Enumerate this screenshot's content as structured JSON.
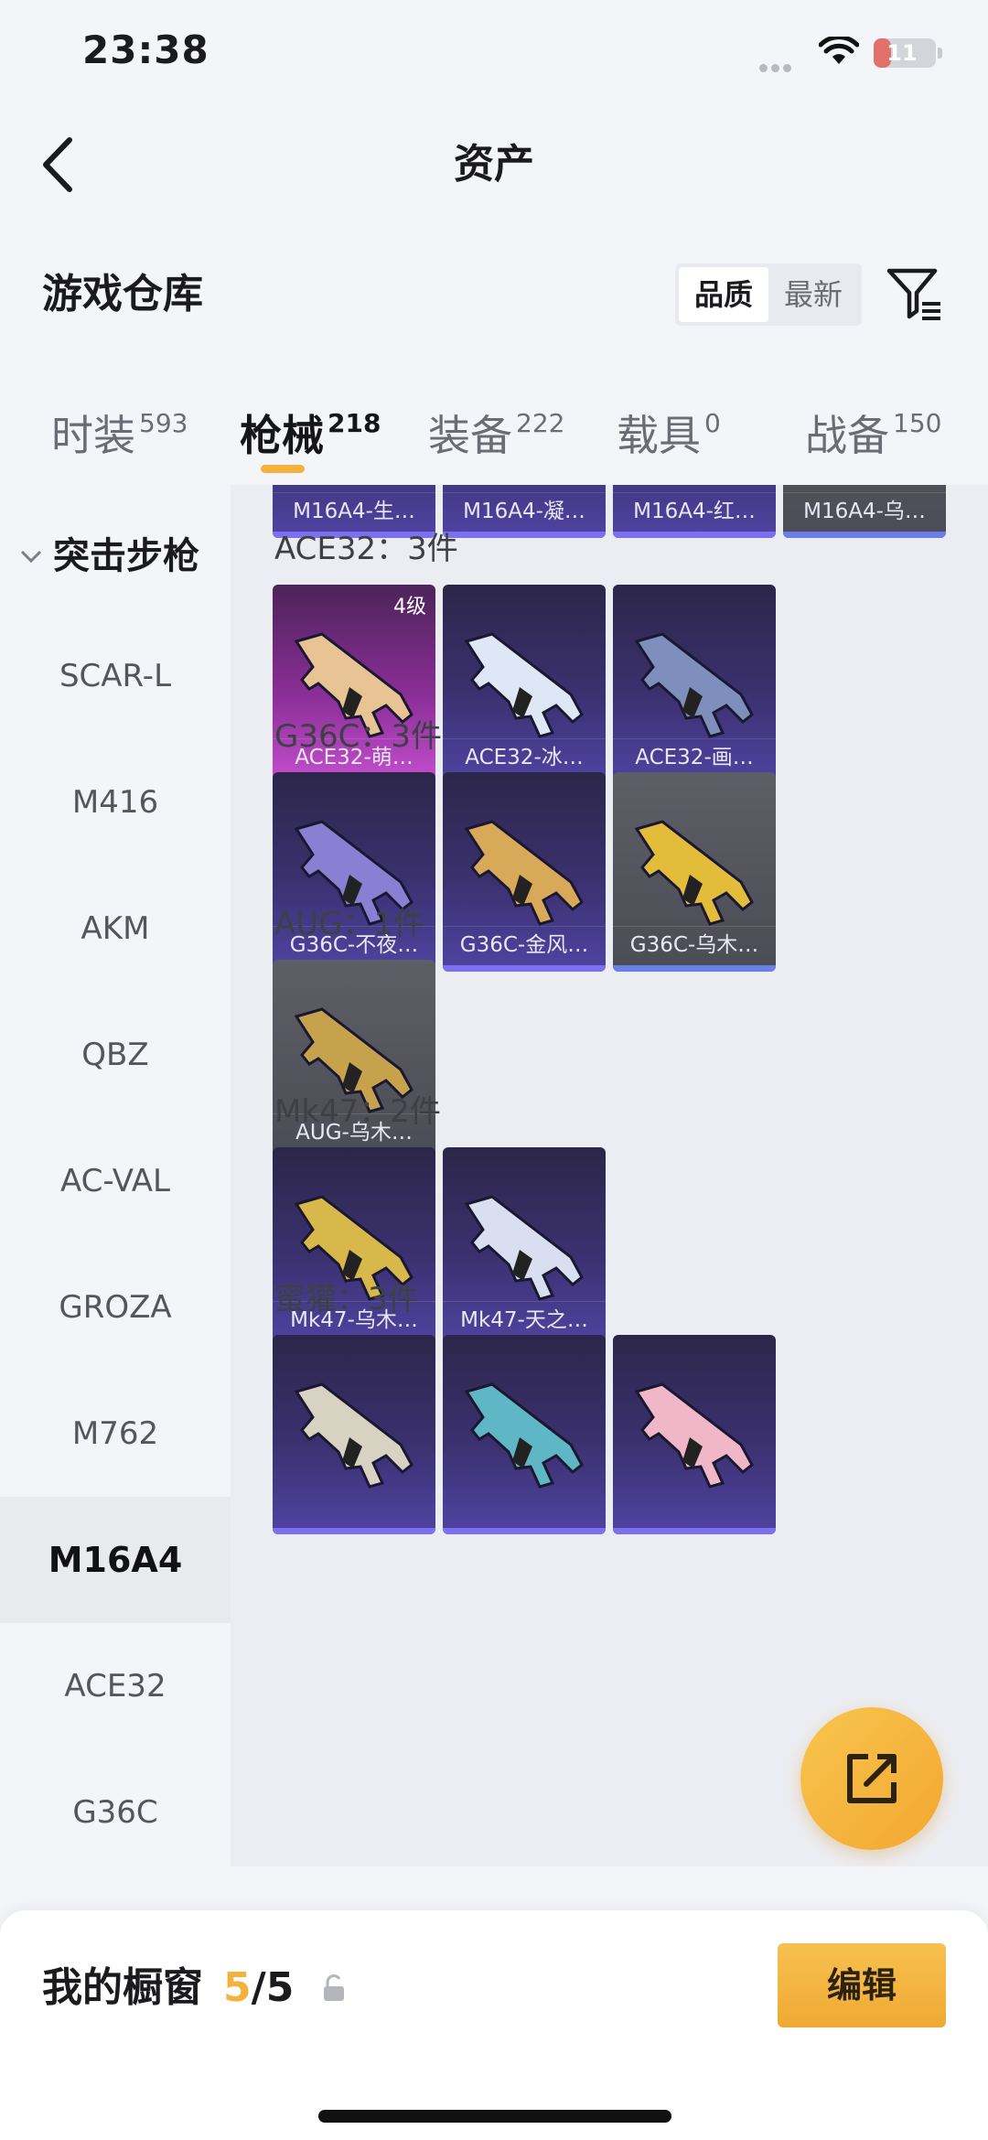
{
  "status_bar": {
    "time": "23:38",
    "battery": "11",
    "battery_level": 0.11
  },
  "nav": {
    "title": "资产"
  },
  "header": {
    "title": "游戏仓库",
    "sort_options": [
      "品质",
      "最新"
    ],
    "active_sort": "品质"
  },
  "tabs": [
    {
      "label": "时装",
      "count": "593"
    },
    {
      "label": "枪械",
      "count": "218"
    },
    {
      "label": "装备",
      "count": "222"
    },
    {
      "label": "载具",
      "count": "0"
    },
    {
      "label": "战备",
      "count": "150"
    }
  ],
  "active_tab": "枪械",
  "sidebar": {
    "group": "突击步枪",
    "items": [
      "SCAR-L",
      "M416",
      "AKM",
      "QBZ",
      "AC-VAL",
      "GROZA",
      "M762",
      "M16A4",
      "ACE32",
      "G36C"
    ],
    "active": "M16A4"
  },
  "sections": [
    {
      "title": "",
      "cards": [
        {
          "name": "M16A4-生…",
          "rarity": "purple"
        },
        {
          "name": "M16A4-凝…",
          "rarity": "purple"
        },
        {
          "name": "M16A4-红…",
          "rarity": "purple"
        },
        {
          "name": "M16A4-乌…",
          "rarity": "grey"
        }
      ]
    },
    {
      "title": "ACE32：3件",
      "cards": [
        {
          "name": "ACE32-萌…",
          "rarity": "pink",
          "level": "4级",
          "gun_color": "#e8c393"
        },
        {
          "name": "ACE32-冰…",
          "rarity": "purple",
          "gun_color": "#dfe6f6"
        },
        {
          "name": "ACE32-画…",
          "rarity": "purple",
          "gun_color": "#7f8fbd"
        }
      ]
    },
    {
      "title": "G36C：3件",
      "cards": [
        {
          "name": "G36C-不夜…",
          "rarity": "purple",
          "gun_color": "#8a7fd2"
        },
        {
          "name": "G36C-金风…",
          "rarity": "purple",
          "gun_color": "#d9a95a"
        },
        {
          "name": "G36C-乌木…",
          "rarity": "grey",
          "gun_color": "#e3bd3a"
        }
      ]
    },
    {
      "title": "AUG：1件",
      "cards": [
        {
          "name": "AUG-乌木…",
          "rarity": "grey",
          "gun_color": "#c7a24c"
        }
      ]
    },
    {
      "title": "Mk47：2件",
      "cards": [
        {
          "name": "Mk47-乌木…",
          "rarity": "purple",
          "gun_color": "#d8b84a"
        },
        {
          "name": "Mk47-天之…",
          "rarity": "purple",
          "gun_color": "#d9dff0"
        }
      ]
    },
    {
      "title": "蜜獾：3件",
      "cards": [
        {
          "name": "",
          "rarity": "purple",
          "gun_color": "#d7d2c2"
        },
        {
          "name": "",
          "rarity": "purple",
          "gun_color": "#5fb7c6"
        },
        {
          "name": "",
          "rarity": "purple",
          "gun_color": "#f0b7c8"
        }
      ]
    }
  ],
  "showcase": {
    "label": "我的橱窗",
    "current": "5",
    "total": "/5"
  },
  "edit_label": "编辑",
  "colors": {
    "accent": "#f4b23c",
    "purple_rarity": "#5143a2",
    "pink_rarity": "#c54fcf"
  }
}
